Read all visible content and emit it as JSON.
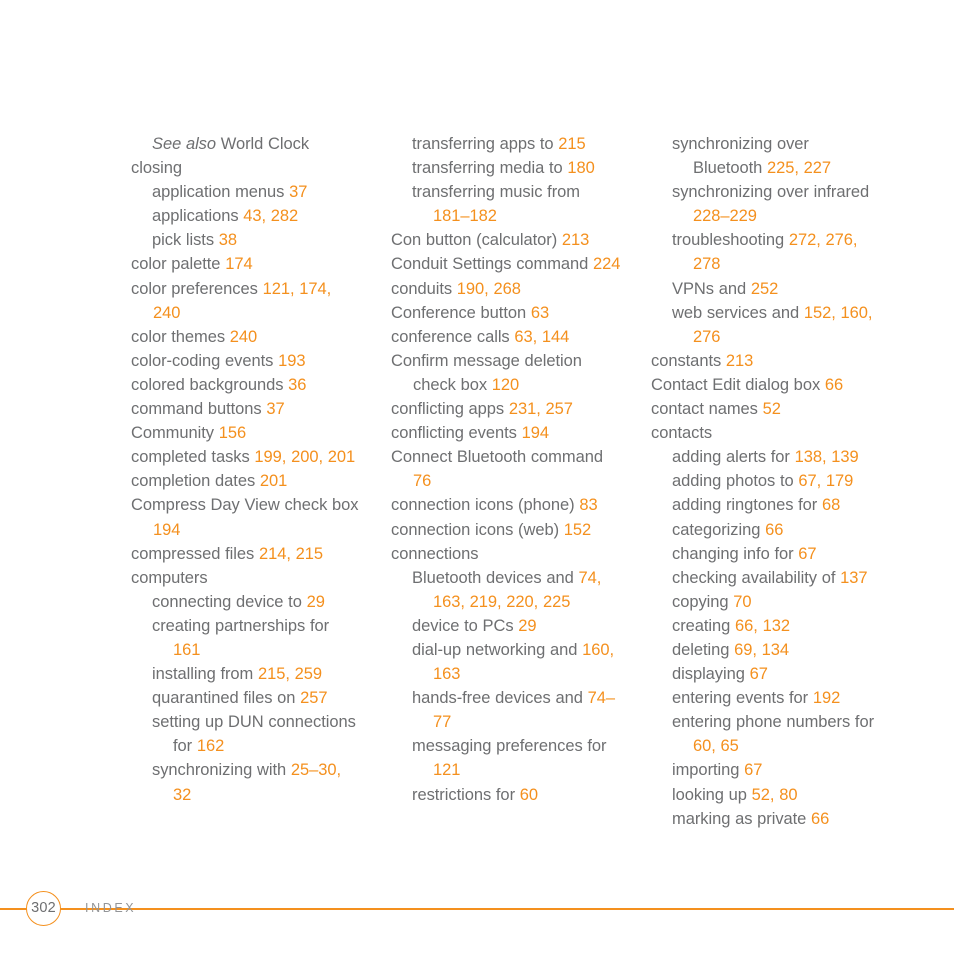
{
  "page": {
    "number": "302",
    "section_label": "INDEX",
    "accent_color": "#f4901e",
    "text_color": "#6e6f71",
    "background_color": "#ffffff"
  },
  "columns": [
    {
      "name": "column-1",
      "entries": [
        {
          "level": 1,
          "text": "See also World Clock",
          "italic_prefix": "See also",
          "rest": " World Clock",
          "pages": ""
        },
        {
          "level": 0,
          "text": "closing",
          "pages": ""
        },
        {
          "level": 1,
          "text": "application menus",
          "pages": "37"
        },
        {
          "level": 1,
          "text": "applications",
          "pages": "43, 282"
        },
        {
          "level": 1,
          "text": "pick lists",
          "pages": "38"
        },
        {
          "level": 0,
          "text": "color palette",
          "pages": "174"
        },
        {
          "level": 0,
          "text": "color preferences",
          "pages": "121, 174, 240"
        },
        {
          "level": 0,
          "text": "color themes",
          "pages": "240"
        },
        {
          "level": 0,
          "text": "color-coding events",
          "pages": "193"
        },
        {
          "level": 0,
          "text": "colored backgrounds",
          "pages": "36"
        },
        {
          "level": 0,
          "text": "command buttons",
          "pages": "37"
        },
        {
          "level": 0,
          "text": "Community",
          "pages": "156"
        },
        {
          "level": 0,
          "text": "completed tasks",
          "pages": "199, 200, 201"
        },
        {
          "level": 0,
          "text": "completion dates",
          "pages": "201"
        },
        {
          "level": 0,
          "text": "Compress Day View check box",
          "pages": "194"
        },
        {
          "level": 0,
          "text": "compressed files",
          "pages": "214, 215"
        },
        {
          "level": 0,
          "text": "computers",
          "pages": ""
        },
        {
          "level": 1,
          "text": "connecting device to",
          "pages": "29"
        },
        {
          "level": 1,
          "text": "creating partnerships for",
          "pages": "161"
        },
        {
          "level": 1,
          "text": "installing from",
          "pages": "215, 259"
        },
        {
          "level": 1,
          "text": "quarantined files on",
          "pages": "257"
        },
        {
          "level": 1,
          "text": "setting up DUN connections for",
          "pages": "162"
        },
        {
          "level": 1,
          "text": "synchronizing with",
          "pages": "25–30, 32"
        }
      ]
    },
    {
      "name": "column-2",
      "entries": [
        {
          "level": 1,
          "text": "transferring apps to",
          "pages": "215"
        },
        {
          "level": 1,
          "text": "transferring media to",
          "pages": "180"
        },
        {
          "level": 1,
          "text": "transferring music from",
          "pages": "181–182"
        },
        {
          "level": 0,
          "text": "Con button (calculator)",
          "pages": "213"
        },
        {
          "level": 0,
          "text": "Conduit Settings command",
          "pages": "224"
        },
        {
          "level": 0,
          "text": "conduits",
          "pages": "190, 268"
        },
        {
          "level": 0,
          "text": "Conference button",
          "pages": "63"
        },
        {
          "level": 0,
          "text": "conference calls",
          "pages": "63, 144"
        },
        {
          "level": 0,
          "text": "Confirm message deletion check box",
          "pages": "120"
        },
        {
          "level": 0,
          "text": "conflicting apps",
          "pages": "231, 257"
        },
        {
          "level": 0,
          "text": "conflicting events",
          "pages": "194"
        },
        {
          "level": 0,
          "text": "Connect Bluetooth command",
          "pages": "76"
        },
        {
          "level": 0,
          "text": "connection icons (phone)",
          "pages": "83"
        },
        {
          "level": 0,
          "text": "connection icons (web)",
          "pages": "152"
        },
        {
          "level": 0,
          "text": "connections",
          "pages": ""
        },
        {
          "level": 1,
          "text": "Bluetooth devices and",
          "pages": "74, 163, 219, 220, 225"
        },
        {
          "level": 1,
          "text": "device to PCs",
          "pages": "29"
        },
        {
          "level": 1,
          "text": "dial-up networking and",
          "pages": "160, 163"
        },
        {
          "level": 1,
          "text": "hands-free devices and",
          "pages": "74–77"
        },
        {
          "level": 1,
          "text": "messaging preferences for",
          "pages": "121"
        },
        {
          "level": 1,
          "text": "restrictions for",
          "pages": "60"
        }
      ]
    },
    {
      "name": "column-3",
      "entries": [
        {
          "level": 1,
          "text": "synchronizing over Bluetooth",
          "pages": "225, 227"
        },
        {
          "level": 1,
          "text": "synchronizing over infrared",
          "pages": "228–229"
        },
        {
          "level": 1,
          "text": "troubleshooting",
          "pages": "272, 276, 278"
        },
        {
          "level": 1,
          "text": "VPNs and",
          "pages": "252"
        },
        {
          "level": 1,
          "text": "web services and",
          "pages": "152, 160, 276"
        },
        {
          "level": 0,
          "text": "constants",
          "pages": "213"
        },
        {
          "level": 0,
          "text": "Contact Edit dialog box",
          "pages": "66"
        },
        {
          "level": 0,
          "text": "contact names",
          "pages": "52"
        },
        {
          "level": 0,
          "text": "contacts",
          "pages": ""
        },
        {
          "level": 1,
          "text": "adding alerts for",
          "pages": "138, 139"
        },
        {
          "level": 1,
          "text": "adding photos to",
          "pages": "67, 179"
        },
        {
          "level": 1,
          "text": "adding ringtones for",
          "pages": "68"
        },
        {
          "level": 1,
          "text": "categorizing",
          "pages": "66"
        },
        {
          "level": 1,
          "text": "changing info for",
          "pages": "67"
        },
        {
          "level": 1,
          "text": "checking availability of",
          "pages": "137"
        },
        {
          "level": 1,
          "text": "copying",
          "pages": "70"
        },
        {
          "level": 1,
          "text": "creating",
          "pages": "66, 132"
        },
        {
          "level": 1,
          "text": "deleting",
          "pages": "69, 134"
        },
        {
          "level": 1,
          "text": "displaying",
          "pages": "67"
        },
        {
          "level": 1,
          "text": "entering events for",
          "pages": "192"
        },
        {
          "level": 1,
          "text": "entering phone numbers for",
          "pages": "60, 65"
        },
        {
          "level": 1,
          "text": "importing",
          "pages": "67"
        },
        {
          "level": 1,
          "text": "looking up",
          "pages": "52, 80"
        },
        {
          "level": 1,
          "text": "marking as private",
          "pages": "66"
        }
      ]
    }
  ]
}
